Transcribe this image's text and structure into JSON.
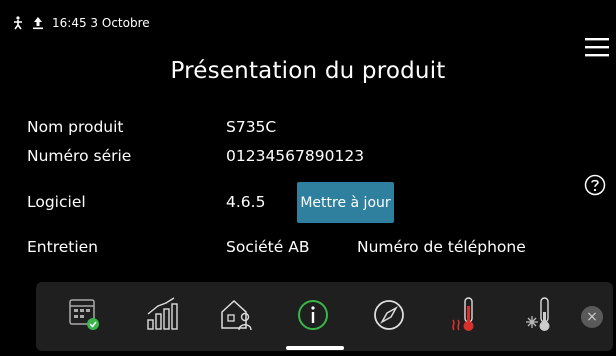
{
  "status": {
    "time": "16:45",
    "date": "3 Octobre"
  },
  "header": {
    "title": "Présentation du produit"
  },
  "info": {
    "model_label": "Nom produit",
    "model_value": "S735C",
    "serial_label": "Numéro série",
    "serial_value": "01234567890123",
    "software_label": "Logiciel",
    "software_value": "4.6.5",
    "update_button": "Mettre à jour",
    "service_label": "Entretien",
    "service_company": "Société AB",
    "service_phone": "Numéro de téléphone"
  },
  "dock": {
    "icons": [
      "calendar-check-icon",
      "bar-chart-icon",
      "house-person-icon",
      "info-icon",
      "compass-icon",
      "thermometer-heat-icon",
      "thermometer-cold-icon"
    ],
    "close_symbol": "×"
  },
  "colors": {
    "accent": "#2f7f9e",
    "green": "#39b54a",
    "red": "#d9302b"
  }
}
